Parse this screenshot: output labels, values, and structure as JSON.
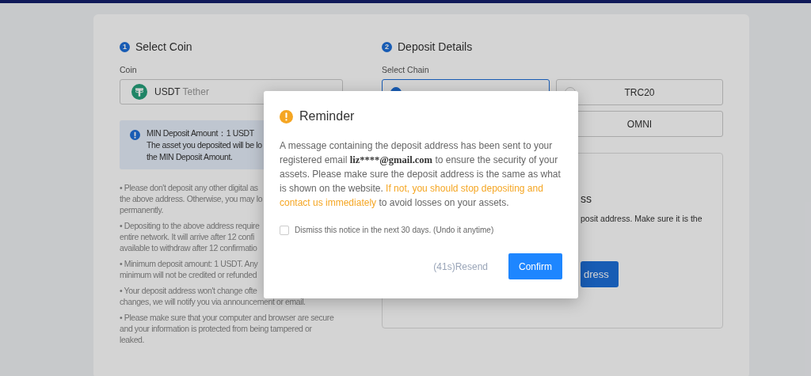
{
  "select_coin": {
    "step": "1",
    "title": "Select Coin",
    "coin_label": "Coin",
    "coin": {
      "symbol": "USDT",
      "name": "Tether"
    },
    "info": {
      "lines": [
        "MIN Deposit Amount：1 USDT",
        "The asset you deposited will be lo",
        "the MIN Deposit Amount."
      ]
    },
    "notes": [
      {
        "lines": [
          "• Please don't deposit any other digital as",
          "the above address. Otherwise, you may lo",
          "permanently."
        ]
      },
      {
        "lines": [
          "• Depositing to the above address require",
          "entire network. It will arrive after 12 confi",
          "available to withdraw after 12 confirmatio"
        ]
      },
      {
        "lines": [
          "• Minimum deposit amount: 1 USDT. Any",
          "minimum will not be credited or refunded"
        ]
      },
      {
        "lines": [
          "• Your deposit address won't change ofte",
          "changes, we will notify you via announcement or email."
        ]
      },
      {
        "lines": [
          "• Please make sure that your computer and browser are secure",
          "and your information is protected from being tampered or",
          "leaked."
        ]
      }
    ]
  },
  "deposit_details": {
    "step": "2",
    "title": "Deposit Details",
    "chain_label": "Select Chain",
    "chains": [
      {
        "selected": true
      },
      {
        "label": "TRC20",
        "selected": false
      },
      {
        "label": "OMNI",
        "selected": false
      }
    ],
    "address_panel": {
      "heading": "ss",
      "text": "posit address. Make sure it is the",
      "button": "dress"
    }
  },
  "dialog": {
    "title": "Reminder",
    "message": [
      {
        "kind": "text",
        "text": "A message containing the deposit address has been sent to your registered email "
      },
      {
        "kind": "email",
        "text": "liz****@gmail.com"
      },
      {
        "kind": "text",
        "text": " to ensure the security of your assets. Please make sure the deposit address is the same as what is shown on the website. "
      },
      {
        "kind": "warning",
        "text": "If not, you should stop depositing and contact us immediately"
      },
      {
        "kind": "text",
        "text": " to avoid losses on your assets."
      }
    ],
    "dismiss": {
      "label": "Dismiss this notice in the next 30 days. (Undo it anytime)",
      "checked": false
    },
    "resend": "(41s)Resend",
    "confirm": "Confirm"
  }
}
